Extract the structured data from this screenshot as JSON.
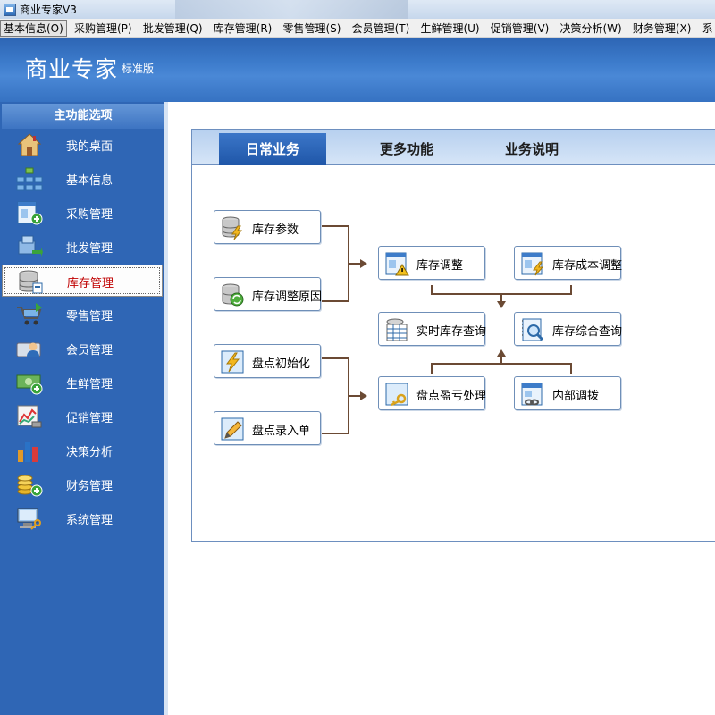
{
  "window": {
    "title": "商业专家V3"
  },
  "menu": [
    {
      "label": "基本信息(O)"
    },
    {
      "label": "采购管理(P)"
    },
    {
      "label": "批发管理(Q)"
    },
    {
      "label": "库存管理(R)"
    },
    {
      "label": "零售管理(S)"
    },
    {
      "label": "会员管理(T)"
    },
    {
      "label": "生鲜管理(U)"
    },
    {
      "label": "促销管理(V)"
    },
    {
      "label": "决策分析(W)"
    },
    {
      "label": "财务管理(X)"
    },
    {
      "label": "系"
    }
  ],
  "header": {
    "title": "商业专家",
    "edition": "标准版"
  },
  "sidebar": {
    "heading": "主功能选项",
    "selected_index": 4,
    "items": [
      {
        "label": "我的桌面",
        "icon": "house-icon"
      },
      {
        "label": "基本信息",
        "icon": "org-chart-icon"
      },
      {
        "label": "采购管理",
        "icon": "purchase-form-icon"
      },
      {
        "label": "批发管理",
        "icon": "boxes-icon"
      },
      {
        "label": "库存管理",
        "icon": "database-icon"
      },
      {
        "label": "零售管理",
        "icon": "cart-icon"
      },
      {
        "label": "会员管理",
        "icon": "member-card-icon"
      },
      {
        "label": "生鲜管理",
        "icon": "money-icon"
      },
      {
        "label": "促销管理",
        "icon": "trend-chart-icon"
      },
      {
        "label": "决策分析",
        "icon": "bar-chart-icon"
      },
      {
        "label": "财务管理",
        "icon": "coins-icon"
      },
      {
        "label": "系统管理",
        "icon": "computer-key-icon"
      }
    ]
  },
  "tabs": [
    {
      "label": "日常业务",
      "active": true
    },
    {
      "label": "更多功能",
      "active": false
    },
    {
      "label": "业务说明",
      "active": false
    }
  ],
  "functions": {
    "inventory_params": {
      "label": "库存参数",
      "icon": "database-lightning-icon"
    },
    "adjust_reasons": {
      "label": "库存调整原因",
      "icon": "database-refresh-icon"
    },
    "stocktake_init": {
      "label": "盘点初始化",
      "icon": "lightning-icon"
    },
    "stocktake_entry": {
      "label": "盘点录入单",
      "icon": "pencil-icon"
    },
    "inventory_adjust": {
      "label": "库存调整",
      "icon": "form-warning-icon"
    },
    "cost_adjust": {
      "label": "库存成本调整",
      "icon": "form-lightning-icon"
    },
    "realtime_query": {
      "label": "实时库存查询",
      "icon": "table-query-icon"
    },
    "summary_query": {
      "label": "库存综合查询",
      "icon": "book-search-icon"
    },
    "profit_loss": {
      "label": "盘点盈亏处理",
      "icon": "key-icon"
    },
    "internal_transfer": {
      "label": "内部调拨",
      "icon": "form-link-icon"
    }
  },
  "colors": {
    "accent": "#2f66b5",
    "connector": "#6b4a34",
    "selected_text": "#c00000"
  }
}
